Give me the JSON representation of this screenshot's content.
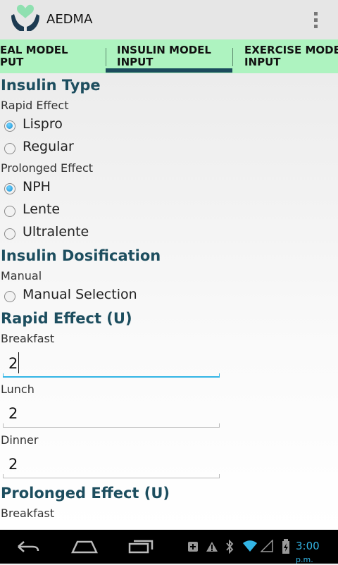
{
  "app": {
    "title": "AEDMA"
  },
  "tabs": [
    {
      "label": "EAL MODEL\nPUT"
    },
    {
      "label": "INSULIN MODEL\nINPUT"
    },
    {
      "label": "EXERCISE MODEL\nINPUT"
    }
  ],
  "insulin_type": {
    "heading": "Insulin Type",
    "rapid_label": "Rapid Effect",
    "rapid_options": [
      "Lispro",
      "Regular"
    ],
    "rapid_selected": "Lispro",
    "prolonged_label": "Prolonged Effect",
    "prolonged_options": [
      "NPH",
      "Lente",
      "Ultralente"
    ],
    "prolonged_selected": "NPH"
  },
  "dosification": {
    "heading": "Insulin Dosification",
    "manual_label": "Manual",
    "manual_option": "Manual Selection"
  },
  "rapid_dose": {
    "heading": "Rapid Effect (U)",
    "breakfast_label": "Breakfast",
    "breakfast_value": "2",
    "lunch_label": "Lunch",
    "lunch_value": "2",
    "dinner_label": "Dinner",
    "dinner_value": "2"
  },
  "prolonged_dose": {
    "heading": "Prolonged Effect (U)",
    "breakfast_label": "Breakfast"
  },
  "status": {
    "time": "3:00",
    "ampm": "p.m."
  },
  "colors": {
    "accent": "#33b5e5",
    "tab_bg": "#aef3c0",
    "heading": "#1d4e5f",
    "logo": "#8fe0b0"
  }
}
